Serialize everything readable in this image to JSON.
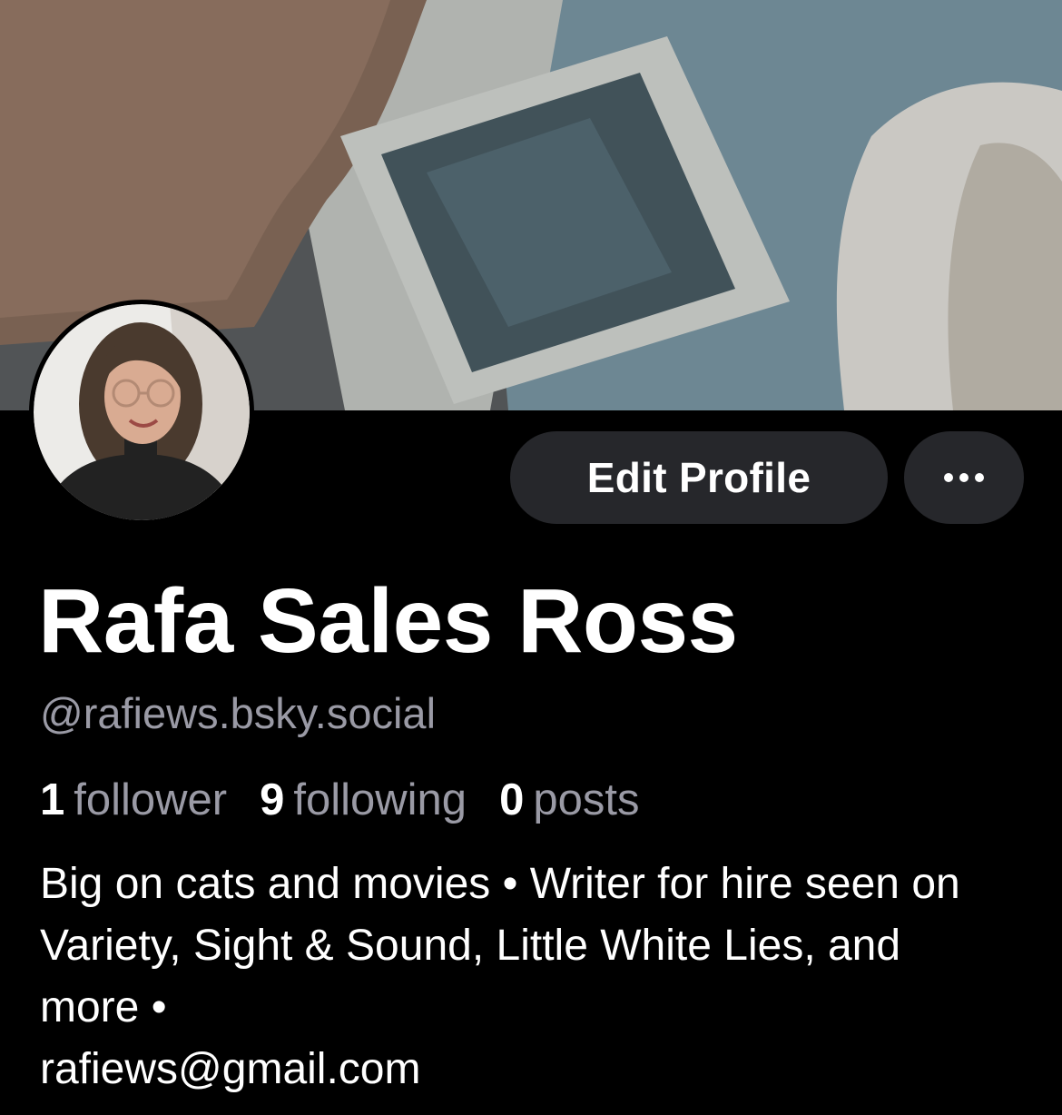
{
  "profile": {
    "display_name": "Rafa Sales Ross",
    "handle": "@rafiews.bsky.social",
    "stats": [
      {
        "count": "1",
        "label": "follower"
      },
      {
        "count": "9",
        "label": "following"
      },
      {
        "count": "0",
        "label": "posts"
      }
    ],
    "bio": "Big on cats and movies • Writer for hire seen on Variety, Sight & Sound, Little White Lies, and more •\nrafiews@gmail.com"
  },
  "actions": {
    "edit_label": "Edit Profile",
    "more_icon": "ellipsis-icon"
  },
  "colors": {
    "background": "#000000",
    "button_bg": "#26272b",
    "secondary_text": "#9a9aa5"
  }
}
